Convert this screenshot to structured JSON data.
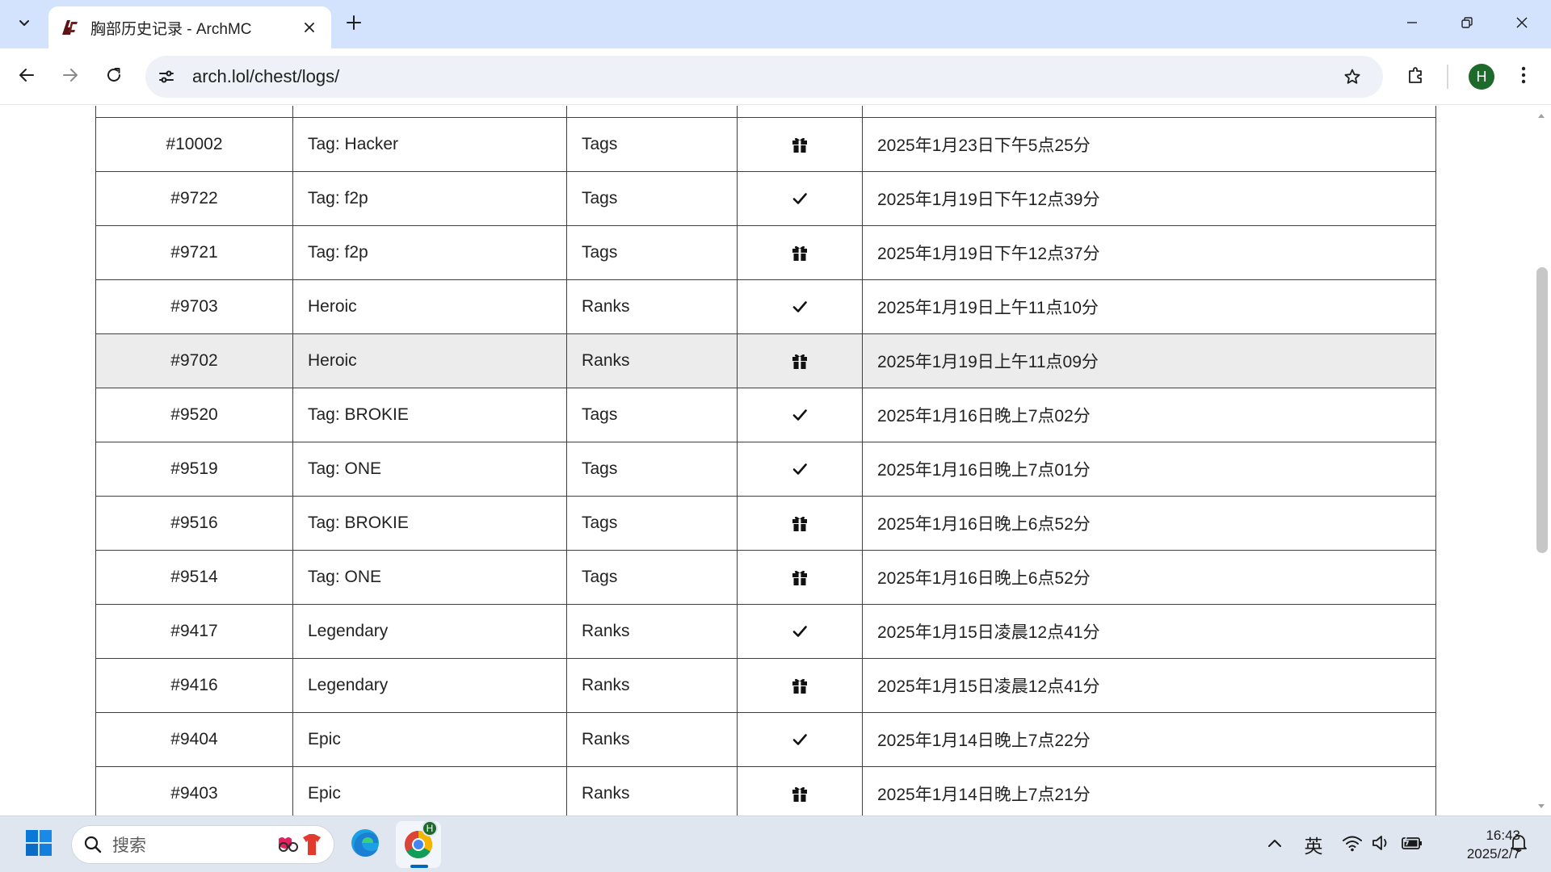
{
  "browser": {
    "tab": {
      "title": "胸部历史记录 - ArchMC"
    },
    "address": {
      "url": "arch.lol/chest/logs/"
    },
    "profile": {
      "initial": "H"
    }
  },
  "table": {
    "rows": [
      {
        "id": "#10002",
        "name": "Tag: Hacker",
        "category": "Tags",
        "status": "gift-icon",
        "date": "2025年1月23日下午5点25分"
      },
      {
        "id": "#9722",
        "name": "Tag: f2p",
        "category": "Tags",
        "status": "check-icon",
        "date": "2025年1月19日下午12点39分"
      },
      {
        "id": "#9721",
        "name": "Tag: f2p",
        "category": "Tags",
        "status": "gift-icon",
        "date": "2025年1月19日下午12点37分"
      },
      {
        "id": "#9703",
        "name": "Heroic",
        "category": "Ranks",
        "status": "check-icon",
        "date": "2025年1月19日上午11点10分"
      },
      {
        "id": "#9702",
        "name": "Heroic",
        "category": "Ranks",
        "status": "gift-icon",
        "date": "2025年1月19日上午11点09分",
        "highlighted": true
      },
      {
        "id": "#9520",
        "name": "Tag: BROKIE",
        "category": "Tags",
        "status": "check-icon",
        "date": "2025年1月16日晚上7点02分"
      },
      {
        "id": "#9519",
        "name": "Tag: ONE",
        "category": "Tags",
        "status": "check-icon",
        "date": "2025年1月16日晚上7点01分"
      },
      {
        "id": "#9516",
        "name": "Tag: BROKIE",
        "category": "Tags",
        "status": "gift-icon",
        "date": "2025年1月16日晚上6点52分"
      },
      {
        "id": "#9514",
        "name": "Tag: ONE",
        "category": "Tags",
        "status": "gift-icon",
        "date": "2025年1月16日晚上6点52分"
      },
      {
        "id": "#9417",
        "name": "Legendary",
        "category": "Ranks",
        "status": "check-icon",
        "date": "2025年1月15日凌晨12点41分"
      },
      {
        "id": "#9416",
        "name": "Legendary",
        "category": "Ranks",
        "status": "gift-icon",
        "date": "2025年1月15日凌晨12点41分"
      },
      {
        "id": "#9404",
        "name": "Epic",
        "category": "Ranks",
        "status": "check-icon",
        "date": "2025年1月14日晚上7点22分"
      },
      {
        "id": "#9403",
        "name": "Epic",
        "category": "Ranks",
        "status": "gift-icon",
        "date": "2025年1月14日晚上7点21分"
      }
    ]
  },
  "taskbar": {
    "search_placeholder": "搜索",
    "ime_label": "英",
    "clock": {
      "time": "16:43",
      "date": "2025/2/7"
    }
  },
  "colors": {
    "tab_strip": "#d3e3fd",
    "row_highlight": "#ececec",
    "profile_avatar": "#1e6a2a",
    "taskbar": "#dfe6ef"
  }
}
